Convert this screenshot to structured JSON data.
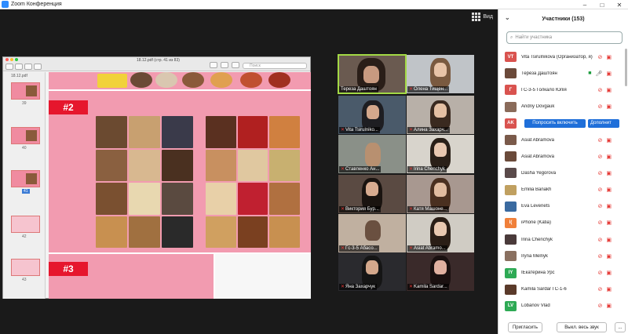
{
  "window": {
    "title": "Zoom Конференция",
    "controls": [
      "–",
      "□",
      "✕"
    ]
  },
  "view_label": "Вид",
  "shared_screen": {
    "doc_title": "18.12.pdf (стр. 41 из 83)",
    "file_label": "18.12.pdf",
    "search_placeholder": "Поиск",
    "thumb_pages": [
      "39",
      "40",
      "41",
      "42",
      "43"
    ],
    "selected_page": "41",
    "slide_badges": [
      "#2",
      "#3"
    ]
  },
  "tiles": [
    {
      "name": "Тереза Даштоян",
      "muted": false,
      "active": true
    },
    {
      "name": "Олена Тищен...",
      "muted": true
    },
    {
      "name": "Vita Tsirulniko...",
      "muted": true
    },
    {
      "name": "Алина Захарч...",
      "muted": true
    },
    {
      "name": "Ставпенко Ан...",
      "muted": true
    },
    {
      "name": "Irina Chenchyk",
      "muted": true
    },
    {
      "name": "Виктория Бур...",
      "muted": true
    },
    {
      "name": "Катя Машоне...",
      "muted": true
    },
    {
      "name": "Гс-3-5 Абасо...",
      "muted": true
    },
    {
      "name": "Asiat Abramo...",
      "muted": true
    },
    {
      "name": "Яна Захарчук",
      "muted": true
    },
    {
      "name": "Kamila Sardar...",
      "muted": true
    }
  ],
  "participants": {
    "title": "Участники (153)",
    "search_placeholder": "Найти участника",
    "list": [
      {
        "initials": "VT",
        "color": "#d9534f",
        "name": "Vita Tsirulnikova (Организатор, я)",
        "photo": false
      },
      {
        "initials": "",
        "color": "#6b4a3a",
        "name": "Тереза Даштоян",
        "photo": true,
        "active": true
      },
      {
        "initials": "Г",
        "color": "#d9534f",
        "name": "ГС-3-5 Голкало Юлія",
        "photo": false
      },
      {
        "initials": "",
        "color": "#8a6b5a",
        "name": "Andriy Dovgauk",
        "photo": true
      },
      {
        "initials": "AK",
        "color": "#d9534f",
        "name": "",
        "photo": false,
        "buttons": true
      },
      {
        "initials": "",
        "color": "#7a5a4a",
        "name": "Asiat Abramova",
        "photo": true
      },
      {
        "initials": "",
        "color": "#6a4a3a",
        "name": "Asiat Abramova",
        "photo": true
      },
      {
        "initials": "",
        "color": "#5a4a4a",
        "name": "Dasha Yegorova",
        "photo": true
      },
      {
        "initials": "",
        "color": "#c0a060",
        "name": "Emilia Banakh",
        "photo": true
      },
      {
        "initials": "",
        "color": "#3a6aa0",
        "name": "Eva Levenets",
        "photo": true
      },
      {
        "initials": "I(",
        "color": "#f0803a",
        "name": "iPhone (Katia)",
        "photo": false
      },
      {
        "initials": "",
        "color": "#4a3a3a",
        "name": "Irina Chenchyk",
        "photo": true
      },
      {
        "initials": "",
        "color": "#8a7060",
        "name": "Iryna Melnyk",
        "photo": true
      },
      {
        "initials": "IY",
        "color": "#2eaa55",
        "name": "IЕкатерина Урс",
        "photo": false
      },
      {
        "initials": "",
        "color": "#5a3a2a",
        "name": "Kamila Sardar ГС-1-6",
        "photo": true
      },
      {
        "initials": "LV",
        "color": "#2eaa55",
        "name": "Lobanov Vlad",
        "photo": false
      }
    ],
    "btn_enable_sound": "Попросить включить",
    "btn_more": "Дополнит",
    "footer": {
      "invite": "Пригласить",
      "mute_all": "Выкл. весь звук",
      "more": "..."
    }
  }
}
